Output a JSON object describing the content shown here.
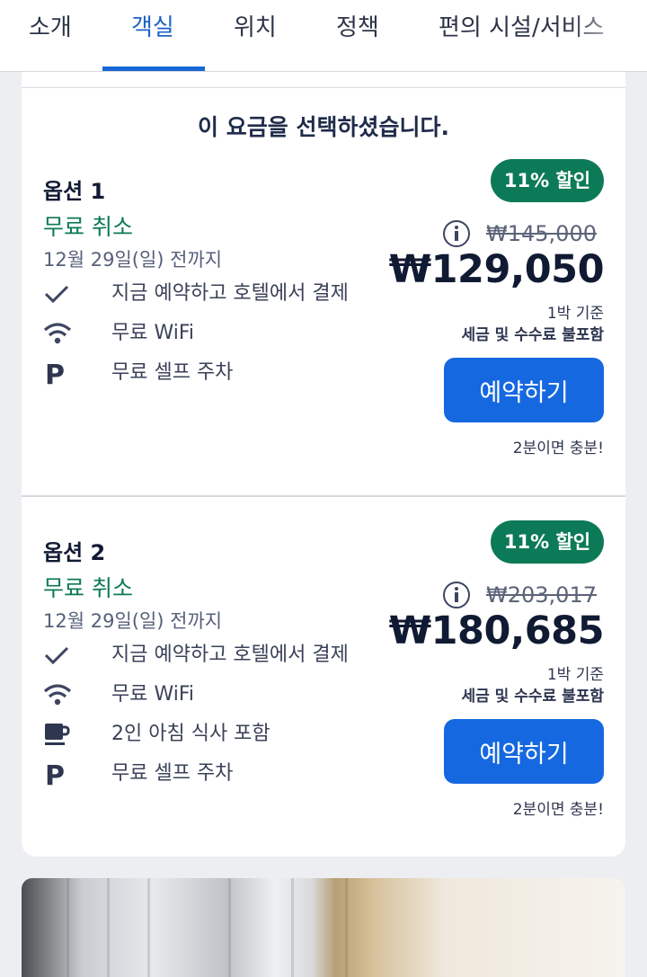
{
  "tabs": [
    {
      "label": "소개"
    },
    {
      "label": "객실"
    },
    {
      "label": "위치"
    },
    {
      "label": "정책"
    },
    {
      "label": "편의 시설/서비스"
    }
  ],
  "active_tab": "객실",
  "selected_message": "이 요금을 선택하셨습니다.",
  "options": [
    {
      "title": "옵션 1",
      "cancellation": "무료 취소",
      "deadline": "12월 29일(일) 전까지",
      "features": [
        {
          "icon": "check-icon",
          "text": "지금 예약하고 호텔에서 결제"
        },
        {
          "icon": "wifi-icon",
          "text": "무료 WiFi"
        },
        {
          "icon": "parking-icon",
          "text": "무료 셀프 주차"
        }
      ],
      "discount_badge": "11% 할인",
      "original_price": "₩145,000",
      "price": "₩129,050",
      "per_night": "1박 기준",
      "tax_note": "세금 및 수수료 불포함",
      "book_label": "예약하기",
      "quick_note": "2분이면 충분!"
    },
    {
      "title": "옵션 2",
      "cancellation": "무료 취소",
      "deadline": "12월 29일(일) 전까지",
      "features": [
        {
          "icon": "check-icon",
          "text": "지금 예약하고 호텔에서 결제"
        },
        {
          "icon": "wifi-icon",
          "text": "무료 WiFi"
        },
        {
          "icon": "coffee-cup-icon",
          "text": "2인 아침 식사 포함"
        },
        {
          "icon": "parking-icon",
          "text": "무료 셀프 주차"
        }
      ],
      "discount_badge": "11% 할인",
      "original_price": "₩203,017",
      "price": "₩180,685",
      "per_night": "1박 기준",
      "tax_note": "세금 및 수수료 불포함",
      "book_label": "예약하기",
      "quick_note": "2분이면 충분!"
    }
  ],
  "colors": {
    "accent_blue": "#1568e0",
    "green": "#0d7a57",
    "text_dark": "#101a33"
  }
}
